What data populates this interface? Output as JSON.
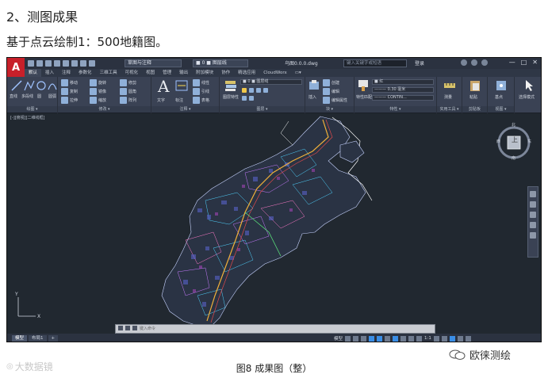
{
  "article": {
    "heading": "2、测图成果",
    "subheading": "基于点云绘制1：500地籍图。",
    "caption": "图8 成果图（整）"
  },
  "app": {
    "logo_letter": "A",
    "workspace": "草图与注释",
    "layer_current": "■ 0 ■ 图层线",
    "doc_title": "乌图0.0.0.dwg",
    "search_placeholder": "键入关键字或短语",
    "signin": "登录",
    "window_buttons": [
      "—",
      "□",
      "✕"
    ]
  },
  "ribbon": {
    "tabs": [
      "默认",
      "插入",
      "注释",
      "参数化",
      "三维工具",
      "可视化",
      "视图",
      "管理",
      "输出",
      "附加模块",
      "协作",
      "精选应用",
      "CloudWorx",
      "▭▾"
    ],
    "active_tab": 0,
    "panels": {
      "draw": {
        "label": "绘图 ▾",
        "items": [
          "直线",
          "多段线",
          "圆",
          "圆弧"
        ]
      },
      "modify": {
        "label": "修改 ▾",
        "items": [
          "移动",
          "旋转",
          "修剪",
          "复制",
          "镜像",
          "圆角",
          "拉伸",
          "缩放",
          "阵列"
        ]
      },
      "annotation": {
        "label": "注释 ▾",
        "items": [
          "文字",
          "标注",
          "线性",
          "引线",
          "表格"
        ]
      },
      "layers": {
        "label": "图层 ▾",
        "items": [
          "图层特性",
          "■ 0 ■ 图层线"
        ]
      },
      "block": {
        "label": "块 ▾",
        "items": [
          "插入",
          "创建",
          "编辑",
          "编辑属性"
        ]
      },
      "properties": {
        "label": "特性 ▾",
        "items": [
          "特性匹配",
          "■ 红",
          "——— 0.30 毫米",
          "——— CONTIN..."
        ]
      },
      "utilities": {
        "label": "实用工具 ▾",
        "items": [
          "测量"
        ]
      },
      "clipboard": {
        "label": "剪贴板",
        "items": [
          "粘贴"
        ]
      },
      "view": {
        "label": "视图 ▾",
        "items": [
          "基点"
        ]
      },
      "select": {
        "label": "",
        "items": [
          "选择模式"
        ]
      }
    }
  },
  "drawing": {
    "view_label": "[-][俯视][二维线框]",
    "viewcube": {
      "north": "北",
      "south": "南",
      "east": "东",
      "west": "西",
      "face": "上"
    },
    "command_placeholder": "键入命令"
  },
  "statusbar": {
    "tabs": [
      "模型",
      "布局1"
    ],
    "active_tab": 0,
    "model_label": "模型",
    "scale": "1:1"
  },
  "watermarks": {
    "left": "大数据镜",
    "right": "欧徕测绘"
  },
  "colors": {
    "background": "#212830",
    "ribbon": "#3a4254",
    "accent": "#3a8ee6",
    "logo_red": "#c8202a"
  }
}
